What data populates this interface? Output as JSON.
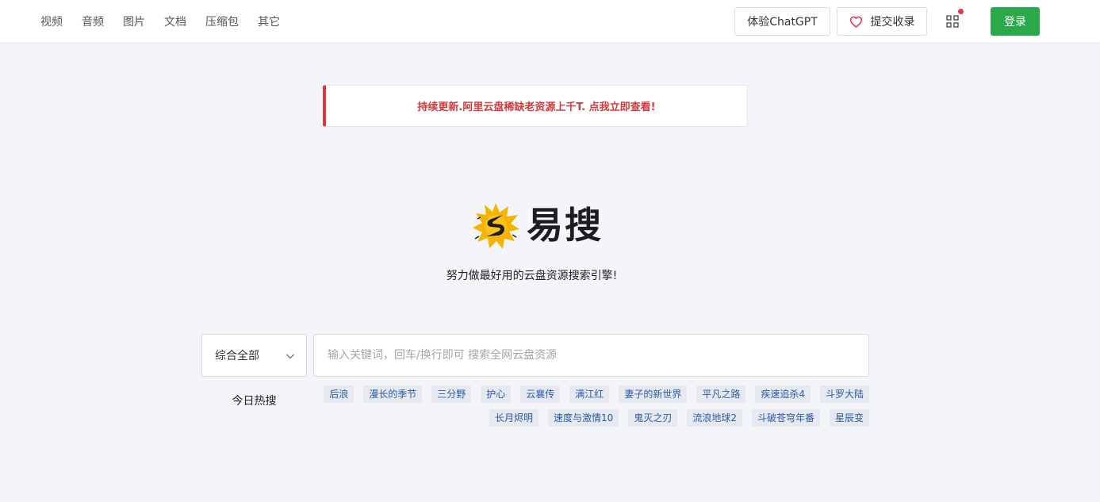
{
  "nav": {
    "items": [
      {
        "label": "视频"
      },
      {
        "label": "音频"
      },
      {
        "label": "图片"
      },
      {
        "label": "文档"
      },
      {
        "label": "压缩包"
      },
      {
        "label": "其它"
      }
    ]
  },
  "header": {
    "chatgpt_label": "体验ChatGPT",
    "submit_label": "提交收录",
    "submit_icon": "heart-icon",
    "apps_icon": "grid-icon",
    "login_label": "登录"
  },
  "notice": {
    "text": "持续更新.阿里云盘稀缺老资源上千T. 点我立即查看!"
  },
  "brand": {
    "name": "易搜",
    "slogan": "努力做最好用的云盘资源搜索引擎!"
  },
  "search": {
    "category": "综合全部",
    "placeholder": "输入关键词，回车/换行即可 搜索全网云盘资源",
    "value": ""
  },
  "hot": {
    "label": "今日热搜",
    "tags": [
      "后浪",
      "漫长的季节",
      "三分野",
      "护心",
      "云襄传",
      "满江红",
      "妻子的新世界",
      "平凡之路",
      "疾速追杀4",
      "斗罗大陆",
      "长月烬明",
      "速度与激情10",
      "鬼灭之刃",
      "流浪地球2",
      "斗破苍穹年番",
      "星辰变"
    ]
  },
  "colors": {
    "accent_green": "#2ba84a",
    "notice_red": "#d03a3f",
    "tag_blue": "#2c5ba8",
    "logo_yellow": "#f5b400"
  }
}
